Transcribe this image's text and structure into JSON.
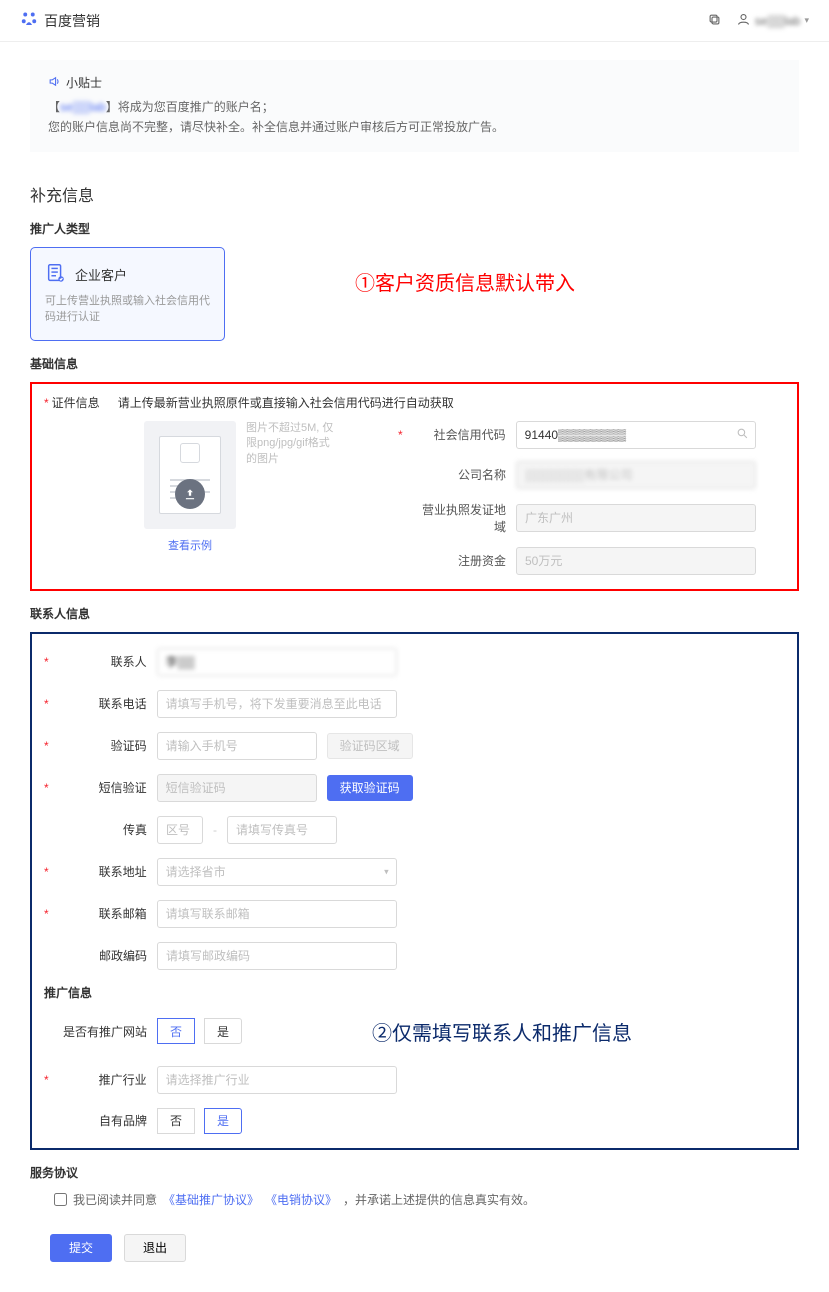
{
  "brand": "百度营销",
  "user": {
    "name": "se▒▒lab"
  },
  "tips": {
    "title": "小贴士",
    "line1_pre": "【",
    "line1_acct": "se▒▒lab",
    "line1_post": "】将成为您百度推广的账户名；",
    "line2": "您的账户信息尚不完整，请尽快补全。补全信息并通过账户审核后方可正常投放广告。"
  },
  "headings": {
    "supplement": "补充信息",
    "promoterType": "推广人类型",
    "basicInfo": "基础信息",
    "contactInfo": "联系人信息",
    "promoInfo": "推广信息",
    "serviceAgreement": "服务协议"
  },
  "card": {
    "title": "企业客户",
    "desc": "可上传营业执照或输入社会信用代码进行认证"
  },
  "annotations": {
    "one": "①客户资质信息默认带入",
    "two": "②仅需填写联系人和推广信息"
  },
  "cert": {
    "label": "证件信息",
    "instruction": "请上传最新营业执照原件或直接输入社会信用代码进行自动获取",
    "uploadHint": "图片不超过5M, 仅限png/jpg/gif格式的图片",
    "viewExample": "查看示例",
    "fields": {
      "socialCodeLabel": "社会信用代码",
      "socialCodeValue": "91440▒▒▒▒▒▒▒▒",
      "companyLabel": "公司名称",
      "companyValue": "▒▒▒▒▒▒▒有限公司",
      "regionLabel": "营业执照发证地域",
      "regionValue": "广东广州",
      "regCapLabel": "注册资金",
      "regCapValue": "50万元"
    }
  },
  "contact": {
    "nameLabel": "联系人",
    "nameValue": "李▒▒",
    "phoneLabel": "联系电话",
    "phonePH": "请填写手机号，将下发重要消息至此电话",
    "verifyLabel": "验证码",
    "verifyPH": "请输入手机号",
    "verifyRegionBtn": "验证码区域",
    "smsLabel": "短信验证",
    "smsPH": "短信验证码",
    "getSmsBtn": "获取验证码",
    "faxLabel": "传真",
    "faxAreaPH": "区号",
    "faxNumPH": "请填写传真号",
    "addrLabel": "联系地址",
    "addrPH": "请选择省市",
    "emailLabel": "联系邮箱",
    "emailPH": "请填写联系邮箱",
    "zipLabel": "邮政编码",
    "zipPH": "请填写邮政编码"
  },
  "promo": {
    "hasSiteLabel": "是否有推广网站",
    "no": "否",
    "yes": "是",
    "industryLabel": "推广行业",
    "industryPH": "请选择推广行业",
    "ownBrandLabel": "自有品牌"
  },
  "agreement": {
    "textPre": "我已阅读并同意",
    "link1": "《基础推广协议》",
    "link2": "《电销协议》",
    "textPost": "，并承诺上述提供的信息真实有效。"
  },
  "buttons": {
    "submit": "提交",
    "exit": "退出"
  }
}
